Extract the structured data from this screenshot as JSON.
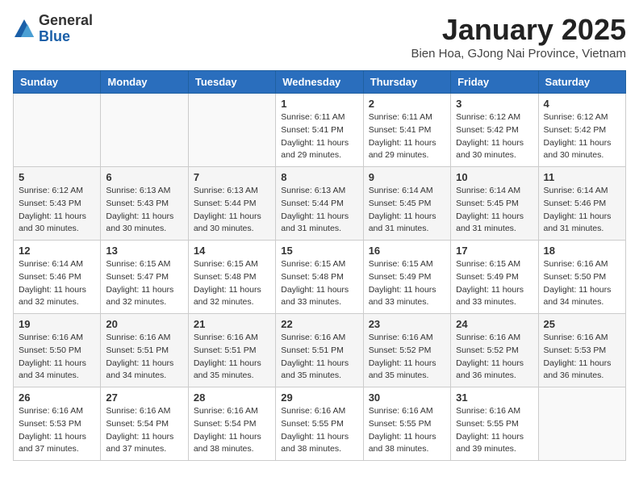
{
  "header": {
    "logo_general": "General",
    "logo_blue": "Blue",
    "month_title": "January 2025",
    "location": "Bien Hoa, GJong Nai Province, Vietnam"
  },
  "weekdays": [
    "Sunday",
    "Monday",
    "Tuesday",
    "Wednesday",
    "Thursday",
    "Friday",
    "Saturday"
  ],
  "weeks": [
    [
      {
        "day": "",
        "info": ""
      },
      {
        "day": "",
        "info": ""
      },
      {
        "day": "",
        "info": ""
      },
      {
        "day": "1",
        "sunrise": "6:11 AM",
        "sunset": "5:41 PM",
        "daylight": "11 hours and 29 minutes."
      },
      {
        "day": "2",
        "sunrise": "6:11 AM",
        "sunset": "5:41 PM",
        "daylight": "11 hours and 29 minutes."
      },
      {
        "day": "3",
        "sunrise": "6:12 AM",
        "sunset": "5:42 PM",
        "daylight": "11 hours and 30 minutes."
      },
      {
        "day": "4",
        "sunrise": "6:12 AM",
        "sunset": "5:42 PM",
        "daylight": "11 hours and 30 minutes."
      }
    ],
    [
      {
        "day": "5",
        "sunrise": "6:12 AM",
        "sunset": "5:43 PM",
        "daylight": "11 hours and 30 minutes."
      },
      {
        "day": "6",
        "sunrise": "6:13 AM",
        "sunset": "5:43 PM",
        "daylight": "11 hours and 30 minutes."
      },
      {
        "day": "7",
        "sunrise": "6:13 AM",
        "sunset": "5:44 PM",
        "daylight": "11 hours and 30 minutes."
      },
      {
        "day": "8",
        "sunrise": "6:13 AM",
        "sunset": "5:44 PM",
        "daylight": "11 hours and 31 minutes."
      },
      {
        "day": "9",
        "sunrise": "6:14 AM",
        "sunset": "5:45 PM",
        "daylight": "11 hours and 31 minutes."
      },
      {
        "day": "10",
        "sunrise": "6:14 AM",
        "sunset": "5:45 PM",
        "daylight": "11 hours and 31 minutes."
      },
      {
        "day": "11",
        "sunrise": "6:14 AM",
        "sunset": "5:46 PM",
        "daylight": "11 hours and 31 minutes."
      }
    ],
    [
      {
        "day": "12",
        "sunrise": "6:14 AM",
        "sunset": "5:46 PM",
        "daylight": "11 hours and 32 minutes."
      },
      {
        "day": "13",
        "sunrise": "6:15 AM",
        "sunset": "5:47 PM",
        "daylight": "11 hours and 32 minutes."
      },
      {
        "day": "14",
        "sunrise": "6:15 AM",
        "sunset": "5:48 PM",
        "daylight": "11 hours and 32 minutes."
      },
      {
        "day": "15",
        "sunrise": "6:15 AM",
        "sunset": "5:48 PM",
        "daylight": "11 hours and 33 minutes."
      },
      {
        "day": "16",
        "sunrise": "6:15 AM",
        "sunset": "5:49 PM",
        "daylight": "11 hours and 33 minutes."
      },
      {
        "day": "17",
        "sunrise": "6:15 AM",
        "sunset": "5:49 PM",
        "daylight": "11 hours and 33 minutes."
      },
      {
        "day": "18",
        "sunrise": "6:16 AM",
        "sunset": "5:50 PM",
        "daylight": "11 hours and 34 minutes."
      }
    ],
    [
      {
        "day": "19",
        "sunrise": "6:16 AM",
        "sunset": "5:50 PM",
        "daylight": "11 hours and 34 minutes."
      },
      {
        "day": "20",
        "sunrise": "6:16 AM",
        "sunset": "5:51 PM",
        "daylight": "11 hours and 34 minutes."
      },
      {
        "day": "21",
        "sunrise": "6:16 AM",
        "sunset": "5:51 PM",
        "daylight": "11 hours and 35 minutes."
      },
      {
        "day": "22",
        "sunrise": "6:16 AM",
        "sunset": "5:51 PM",
        "daylight": "11 hours and 35 minutes."
      },
      {
        "day": "23",
        "sunrise": "6:16 AM",
        "sunset": "5:52 PM",
        "daylight": "11 hours and 35 minutes."
      },
      {
        "day": "24",
        "sunrise": "6:16 AM",
        "sunset": "5:52 PM",
        "daylight": "11 hours and 36 minutes."
      },
      {
        "day": "25",
        "sunrise": "6:16 AM",
        "sunset": "5:53 PM",
        "daylight": "11 hours and 36 minutes."
      }
    ],
    [
      {
        "day": "26",
        "sunrise": "6:16 AM",
        "sunset": "5:53 PM",
        "daylight": "11 hours and 37 minutes."
      },
      {
        "day": "27",
        "sunrise": "6:16 AM",
        "sunset": "5:54 PM",
        "daylight": "11 hours and 37 minutes."
      },
      {
        "day": "28",
        "sunrise": "6:16 AM",
        "sunset": "5:54 PM",
        "daylight": "11 hours and 38 minutes."
      },
      {
        "day": "29",
        "sunrise": "6:16 AM",
        "sunset": "5:55 PM",
        "daylight": "11 hours and 38 minutes."
      },
      {
        "day": "30",
        "sunrise": "6:16 AM",
        "sunset": "5:55 PM",
        "daylight": "11 hours and 38 minutes."
      },
      {
        "day": "31",
        "sunrise": "6:16 AM",
        "sunset": "5:55 PM",
        "daylight": "11 hours and 39 minutes."
      },
      {
        "day": "",
        "info": ""
      }
    ]
  ]
}
